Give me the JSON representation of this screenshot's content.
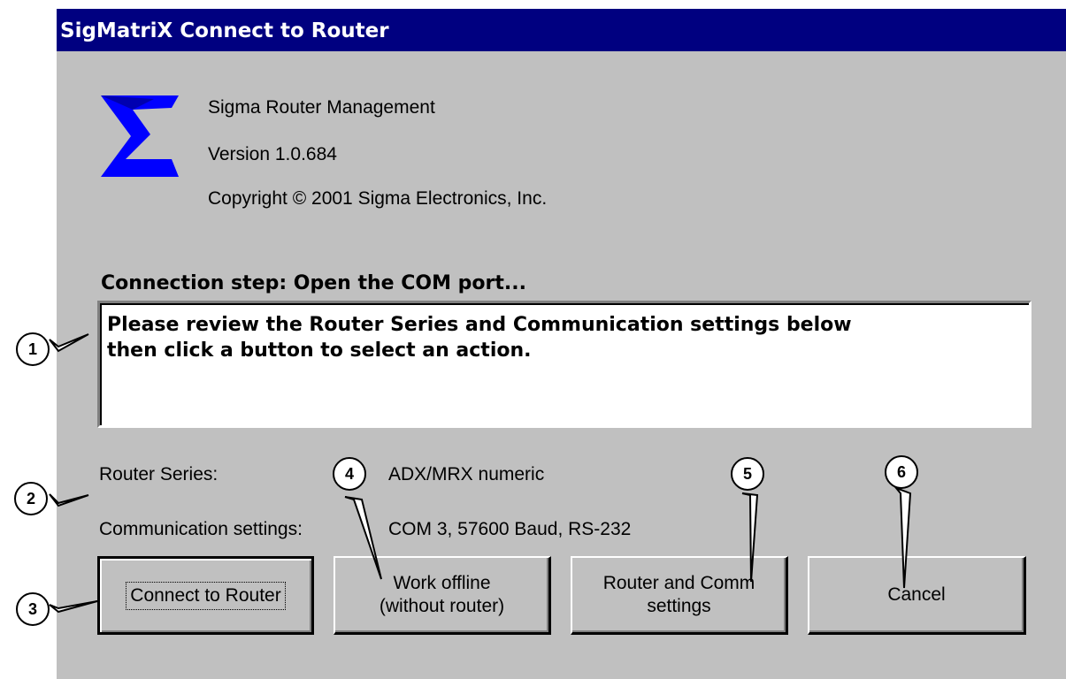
{
  "window": {
    "title": "SigMatriX Connect to Router"
  },
  "about": {
    "product": "Sigma Router Management",
    "version": "Version 1.0.684",
    "copyright": "Copyright © 2001 Sigma Electronics, Inc."
  },
  "status": {
    "step": "Connection step:  Open the COM port...",
    "message_line1": "Please review the Router Series and Communication settings below",
    "message_line2": "then click a button to select an action."
  },
  "settings": {
    "series_label": "Router Series:",
    "series_value": "ADX/MRX numeric",
    "comm_label": "Communication settings:",
    "comm_value": "COM 3, 57600 Baud, RS-232"
  },
  "buttons": {
    "connect": "Connect to Router",
    "offline_line1": "Work offline",
    "offline_line2": "(without router)",
    "settings_line1": "Router and Comm",
    "settings_line2": "settings",
    "cancel": "Cancel"
  },
  "callouts": [
    "1",
    "2",
    "3",
    "4",
    "5",
    "6"
  ],
  "colors": {
    "titlebar": "#000080",
    "dialog": "#c0c0c0",
    "logo": "#0000ff"
  }
}
